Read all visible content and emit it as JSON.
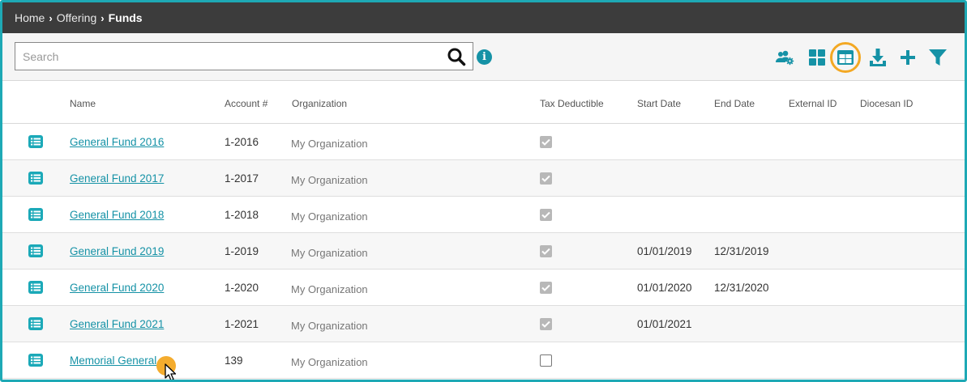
{
  "breadcrumb": {
    "items": [
      "Home",
      "Offering"
    ],
    "current": "Funds"
  },
  "search": {
    "placeholder": "Search",
    "value": ""
  },
  "toolbar": {
    "icons": [
      "people-settings-icon",
      "tile-view-icon",
      "table-view-icon",
      "download-icon",
      "add-icon",
      "filter-icon"
    ],
    "selected": "table-view-icon",
    "accent": "#1592a6",
    "highlight": "#f3a823"
  },
  "table": {
    "columns": [
      "Name",
      "Account #",
      "Organization",
      "Tax Deductible",
      "Start Date",
      "End Date",
      "External ID",
      "Diocesan ID"
    ],
    "rows": [
      {
        "name": "General Fund 2016",
        "account": "1-2016",
        "organization": "My Organization",
        "tax_deductible": true,
        "start_date": "",
        "end_date": "",
        "external_id": "",
        "diocesan_id": ""
      },
      {
        "name": "General Fund 2017",
        "account": "1-2017",
        "organization": "My Organization",
        "tax_deductible": true,
        "start_date": "",
        "end_date": "",
        "external_id": "",
        "diocesan_id": ""
      },
      {
        "name": "General Fund 2018",
        "account": "1-2018",
        "organization": "My Organization",
        "tax_deductible": true,
        "start_date": "",
        "end_date": "",
        "external_id": "",
        "diocesan_id": ""
      },
      {
        "name": "General Fund 2019",
        "account": "1-2019",
        "organization": "My Organization",
        "tax_deductible": true,
        "start_date": "01/01/2019",
        "end_date": "12/31/2019",
        "external_id": "",
        "diocesan_id": ""
      },
      {
        "name": "General Fund 2020",
        "account": "1-2020",
        "organization": "My Organization",
        "tax_deductible": true,
        "start_date": "01/01/2020",
        "end_date": "12/31/2020",
        "external_id": "",
        "diocesan_id": ""
      },
      {
        "name": "General Fund 2021",
        "account": "1-2021",
        "organization": "My Organization",
        "tax_deductible": true,
        "start_date": "01/01/2021",
        "end_date": "",
        "external_id": "",
        "diocesan_id": ""
      },
      {
        "name": "Memorial General",
        "account": "139",
        "organization": "My Organization",
        "tax_deductible": false,
        "start_date": "",
        "end_date": "",
        "external_id": "",
        "diocesan_id": ""
      }
    ]
  }
}
